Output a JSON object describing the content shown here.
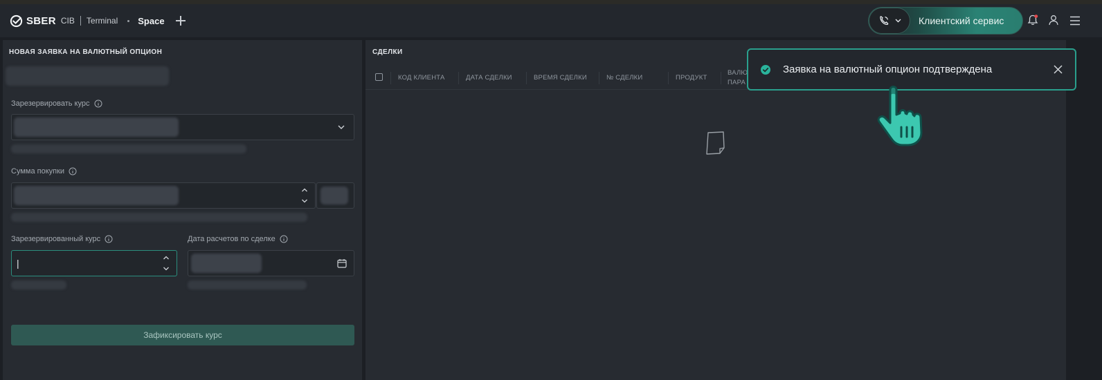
{
  "header": {
    "logo_brand": "SBER",
    "logo_cib": "CIB",
    "logo_terminal": "Terminal",
    "space_label": "Space",
    "client_service_label": "Клиентский сервис"
  },
  "left_panel": {
    "title": "НОВАЯ ЗАЯВКА НА ВАЛЮТНЫЙ ОПЦИОН",
    "reserve_rate_label": "Зарезервировать курс",
    "purchase_amount_label": "Сумма покупки",
    "reserved_rate_label": "Зарезервированный курс",
    "reserved_rate_value": "|",
    "settlement_date_label": "Дата расчетов по сделке",
    "fix_rate_button": "Зафиксировать курс"
  },
  "deals_panel": {
    "title": "СДЕЛКИ",
    "columns": [
      "КОД КЛИЕНТА",
      "ДАТА СДЕЛКИ",
      "ВРЕМЯ СДЕЛКИ",
      "№ СДЕЛКИ",
      "ПРОДУКТ",
      "ВАЛЮ",
      "ПАРА"
    ]
  },
  "toast": {
    "message": "Заявка на валютный опцион подтверждена"
  },
  "colors": {
    "accent": "#2aa08d",
    "button_bg": "#2f5953",
    "notification_dot": "#e5484d"
  }
}
